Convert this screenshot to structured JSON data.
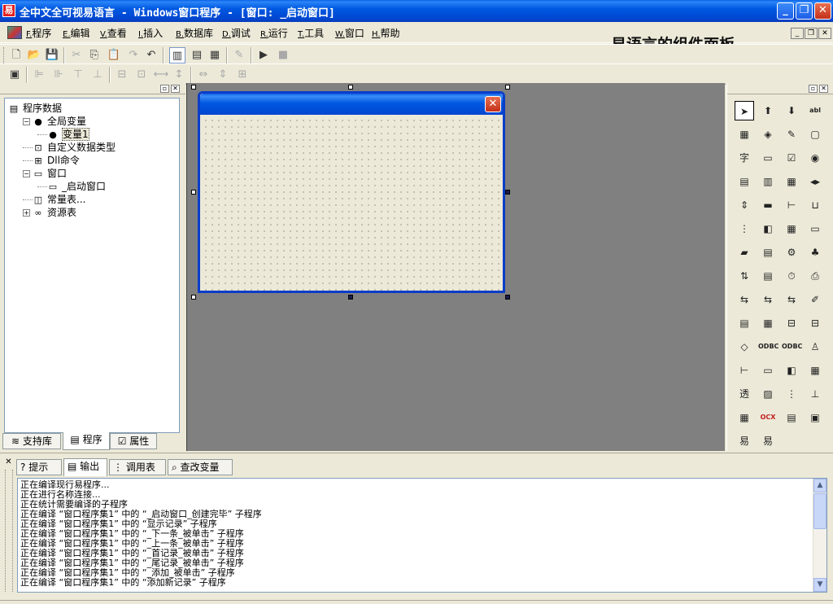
{
  "window": {
    "app_icon": "易",
    "title": "全中文全可视易语言 - Windows窗口程序 - [窗口: _启动窗口]",
    "minimize_icon": "_",
    "restore_icon": "❐",
    "close_icon": "✕"
  },
  "menu": {
    "items": [
      {
        "accel": "F.",
        "label": "程序"
      },
      {
        "accel": "E.",
        "label": "编辑"
      },
      {
        "accel": "V.",
        "label": "查看"
      },
      {
        "accel": "I.",
        "label": "插入"
      },
      {
        "accel": "B.",
        "label": "数据库"
      },
      {
        "accel": "D.",
        "label": "调试"
      },
      {
        "accel": "R.",
        "label": "运行"
      },
      {
        "accel": "T.",
        "label": "工具"
      },
      {
        "accel": "W.",
        "label": "窗口"
      },
      {
        "accel": "H.",
        "label": "帮助"
      }
    ],
    "mdi_min": "_",
    "mdi_restore": "❐",
    "mdi_close": "✕"
  },
  "annotation": {
    "text": "易语言的组件面板"
  },
  "tree": {
    "items": [
      {
        "label": "程序数据",
        "icon": "▤",
        "depth": 0,
        "expander": ""
      },
      {
        "label": "全局变量",
        "icon": "●",
        "depth": 1,
        "expander": "−"
      },
      {
        "label": "变量1",
        "icon": "●",
        "depth": 2,
        "expander": "",
        "selected": true
      },
      {
        "label": "自定义数据类型",
        "icon": "⊡",
        "depth": 1,
        "expander": ""
      },
      {
        "label": "Dll命令",
        "icon": "⊞",
        "depth": 1,
        "expander": ""
      },
      {
        "label": "窗口",
        "icon": "▭",
        "depth": 1,
        "expander": "−"
      },
      {
        "label": "_启动窗口",
        "icon": "▭",
        "depth": 2,
        "expander": ""
      },
      {
        "label": "常量表...",
        "icon": "◫",
        "depth": 1,
        "expander": ""
      },
      {
        "label": "资源表",
        "icon": "∞",
        "depth": 1,
        "expander": "+"
      }
    ]
  },
  "left_tabs": [
    {
      "label": "支持库",
      "icon": "≋"
    },
    {
      "label": "程序",
      "icon": "▤"
    },
    {
      "label": "属性",
      "icon": "☑"
    }
  ],
  "bottom_tabs": [
    {
      "label": "提示",
      "icon": "?"
    },
    {
      "label": "输出",
      "icon": "▤"
    },
    {
      "label": "调用表",
      "icon": "⋮"
    },
    {
      "label": "查改变量",
      "icon": "⌕"
    }
  ],
  "output": {
    "lines": [
      "正在编译现行易程序...",
      "正在进行名称连接...",
      "正在统计需要编译的子程序",
      "正在编译 “窗口程序集1” 中的 “_启动窗口_创建完毕” 子程序",
      "正在编译 “窗口程序集1” 中的 “显示记录” 子程序",
      "正在编译 “窗口程序集1” 中的 “_下一条_被单击” 子程序",
      "正在编译 “窗口程序集1” 中的 “_上一条_被单击” 子程序",
      "正在编译 “窗口程序集1” 中的 “_首记录_被单击” 子程序",
      "正在编译 “窗口程序集1” 中的 “_尾记录_被单击” 子程序",
      "正在编译 “窗口程序集1” 中的 “_添加_被单击” 子程序",
      "正在编译 “窗口程序集1” 中的 “添加新记录” 子程序"
    ]
  },
  "components": [
    [
      "➤",
      "⬆",
      "⬇",
      "abl"
    ],
    [
      "▦",
      "◈",
      "✎",
      "▢"
    ],
    [
      "字",
      "▭",
      "☑",
      "◉"
    ],
    [
      "▤",
      "▥",
      "▦",
      "◂▸"
    ],
    [
      "⇕",
      "▬",
      "⊢",
      "⊔"
    ],
    [
      "⋮",
      "◧",
      "▦",
      "▭"
    ],
    [
      "▰",
      "▤",
      "⚙",
      "♣"
    ],
    [
      "⇅",
      "▤",
      "⏱",
      "⎙"
    ],
    [
      "⇆",
      "⇆",
      "⇆",
      "✐"
    ],
    [
      "▤",
      "▦",
      "⊟",
      "⊟"
    ],
    [
      "◇",
      "ODBC",
      "ODBC",
      "♙"
    ],
    [
      "⊢",
      "▭",
      "◧",
      "▦"
    ],
    [
      "透",
      "▨",
      "⋮",
      "⊥"
    ],
    [
      "▦",
      "OCX",
      "▤",
      "▣"
    ],
    [
      "易",
      "易",
      "",
      ""
    ]
  ]
}
